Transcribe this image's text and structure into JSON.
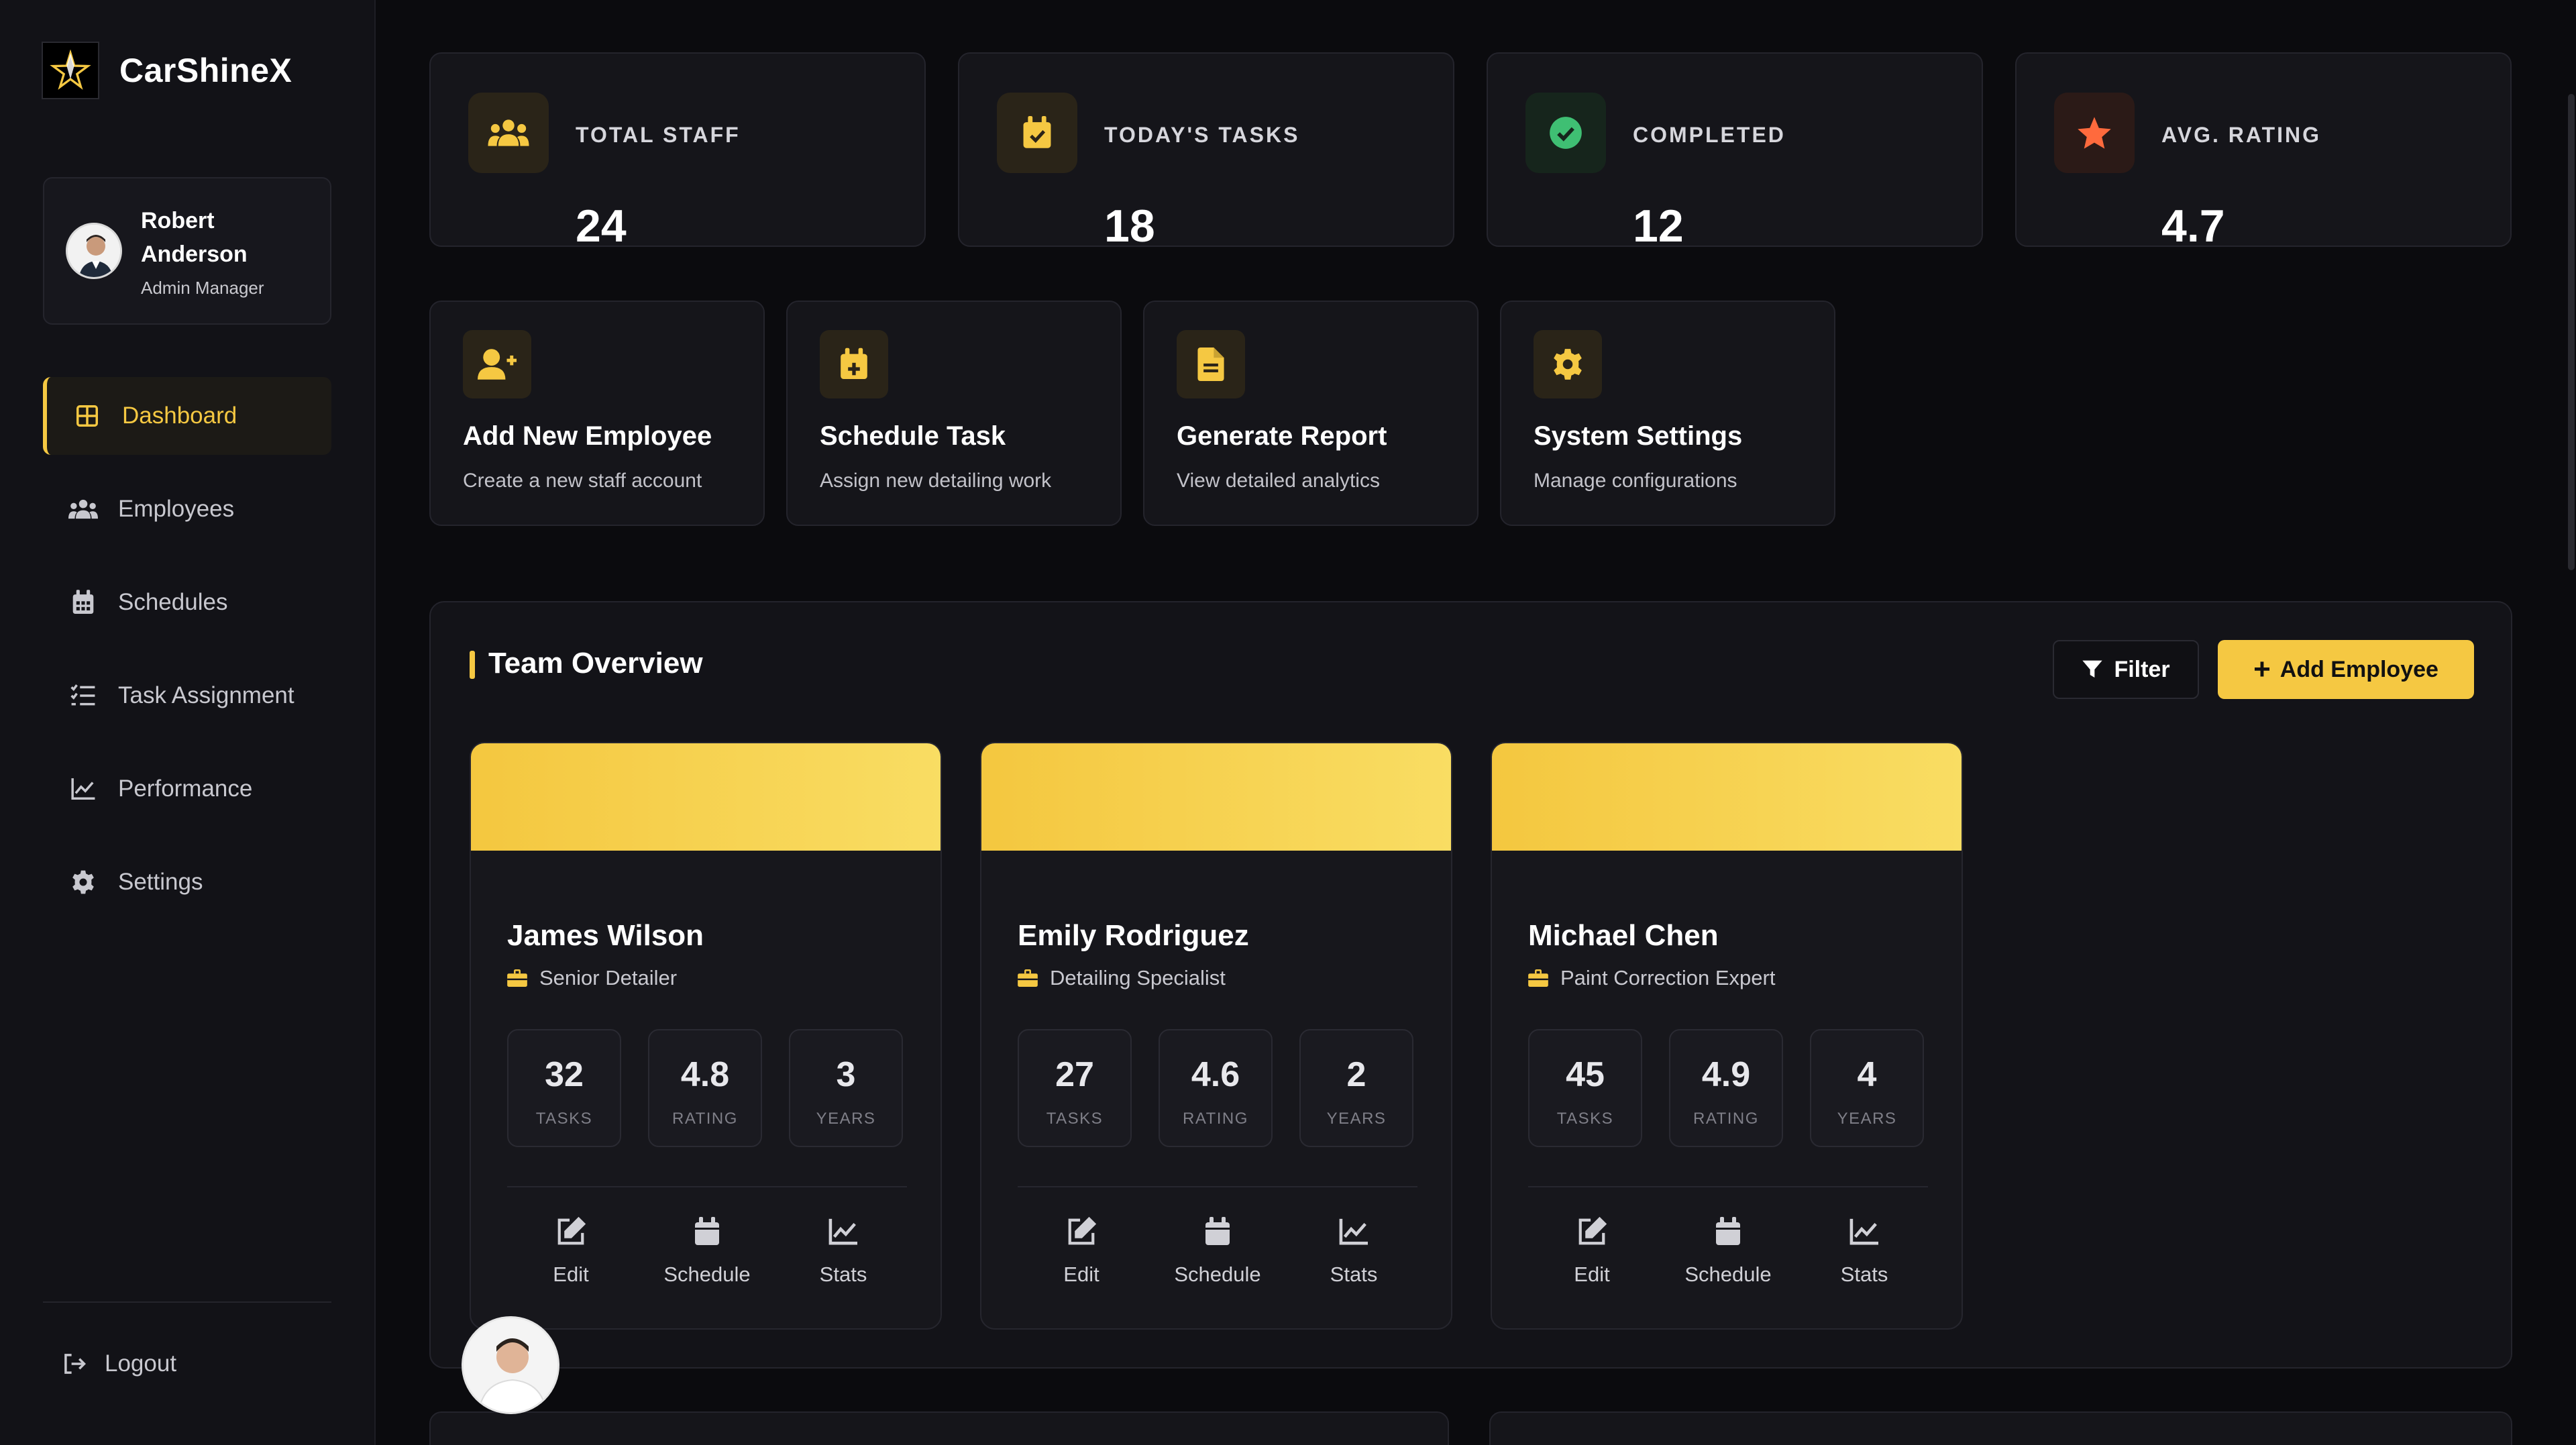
{
  "app": {
    "name": "CarShineX",
    "logo_icon": "star-icon"
  },
  "profile": {
    "name": "Robert Anderson",
    "role": "Admin Manager"
  },
  "nav": {
    "items": [
      {
        "label": "Dashboard",
        "icon": "dashboard-grid-icon",
        "active": true
      },
      {
        "label": "Employees",
        "icon": "users-icon",
        "active": false
      },
      {
        "label": "Schedules",
        "icon": "calendar-icon",
        "active": false
      },
      {
        "label": "Task Assignment",
        "icon": "task-list-icon",
        "active": false
      },
      {
        "label": "Performance",
        "icon": "chart-line-icon",
        "active": false
      },
      {
        "label": "Settings",
        "icon": "gear-icon",
        "active": false
      }
    ],
    "logout": "Logout"
  },
  "stats": [
    {
      "label": "TOTAL STAFF",
      "value": "24",
      "icon": "users-icon",
      "color": "#f5c842"
    },
    {
      "label": "TODAY'S TASKS",
      "value": "18",
      "icon": "calendar-check-icon",
      "color": "#f5c842"
    },
    {
      "label": "COMPLETED",
      "value": "12",
      "icon": "check-circle-icon",
      "color": "#3fbf73"
    },
    {
      "label": "AVG. RATING",
      "value": "4.7",
      "icon": "star-icon",
      "color": "#ff6a3d"
    }
  ],
  "actions": [
    {
      "title": "Add New Employee",
      "subtitle": "Create a new staff account",
      "icon": "user-plus-icon"
    },
    {
      "title": "Schedule Task",
      "subtitle": "Assign new detailing work",
      "icon": "calendar-plus-icon"
    },
    {
      "title": "Generate Report",
      "subtitle": "View detailed analytics",
      "icon": "file-report-icon"
    },
    {
      "title": "System Settings",
      "subtitle": "Manage configurations",
      "icon": "gear-icon"
    }
  ],
  "team": {
    "title": "Team Overview",
    "filter_label": "Filter",
    "add_label": "Add Employee",
    "employees": [
      {
        "name": "James Wilson",
        "role": "Senior Detailer",
        "stats": [
          {
            "value": "32",
            "label": "TASKS"
          },
          {
            "value": "4.8",
            "label": "RATING"
          },
          {
            "value": "3",
            "label": "YEARS"
          }
        ],
        "actions": [
          "Edit",
          "Schedule",
          "Stats"
        ]
      },
      {
        "name": "Emily Rodriguez",
        "role": "Detailing Specialist",
        "stats": [
          {
            "value": "27",
            "label": "TASKS"
          },
          {
            "value": "4.6",
            "label": "RATING"
          },
          {
            "value": "2",
            "label": "YEARS"
          }
        ],
        "actions": [
          "Edit",
          "Schedule",
          "Stats"
        ]
      },
      {
        "name": "Michael Chen",
        "role": "Paint Correction Expert",
        "stats": [
          {
            "value": "45",
            "label": "TASKS"
          },
          {
            "value": "4.9",
            "label": "RATING"
          },
          {
            "value": "4",
            "label": "YEARS"
          }
        ],
        "actions": [
          "Edit",
          "Schedule",
          "Stats"
        ]
      }
    ]
  },
  "colors": {
    "accent": "#f5c842",
    "background": "#0b0b0e",
    "sidebar": "#121217",
    "card": "#15151a"
  }
}
